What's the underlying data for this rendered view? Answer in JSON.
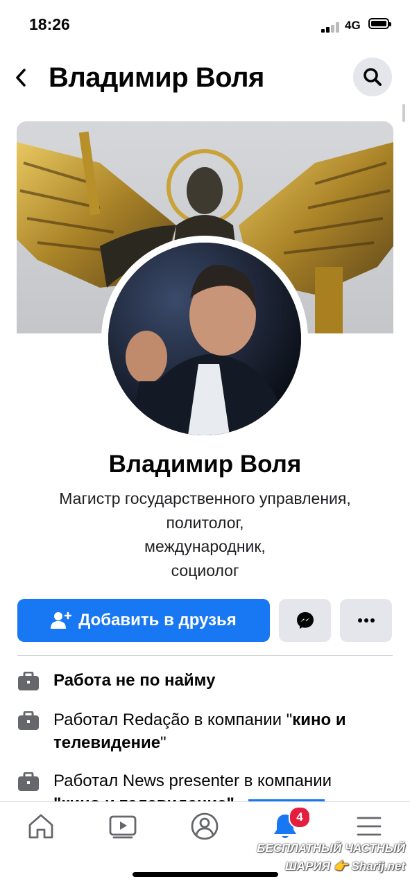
{
  "status": {
    "time": "18:26",
    "network": "4G"
  },
  "header": {
    "title": "Владимир Воля"
  },
  "profile": {
    "name": "Владимир Воля",
    "bio_lines": [
      "Магистр государственного управления,",
      "политолог,",
      "международник,",
      "социолог"
    ]
  },
  "actions": {
    "add_friend_label": "Добавить в друзья",
    "more_label": "···"
  },
  "info": [
    {
      "bold": "Работа не по найму"
    },
    {
      "prefix": "Работал Redação в компании \"",
      "bold": "кино и телевидение",
      "suffix": "\""
    },
    {
      "prefix": "Работал News presenter в компании",
      "line2": "\"кино и телевидение\""
    }
  ],
  "tabbar": {
    "notifications_count": "4"
  },
  "watermark": {
    "line1": "БЕСПЛАТНЫЙ ЧАСТНЫЙ",
    "line2": "ШАРИЯ 👉 Sharij.net"
  },
  "colors": {
    "accent": "#1877f2",
    "button_gray": "#e4e6eb",
    "badge": "#e41e3f"
  }
}
